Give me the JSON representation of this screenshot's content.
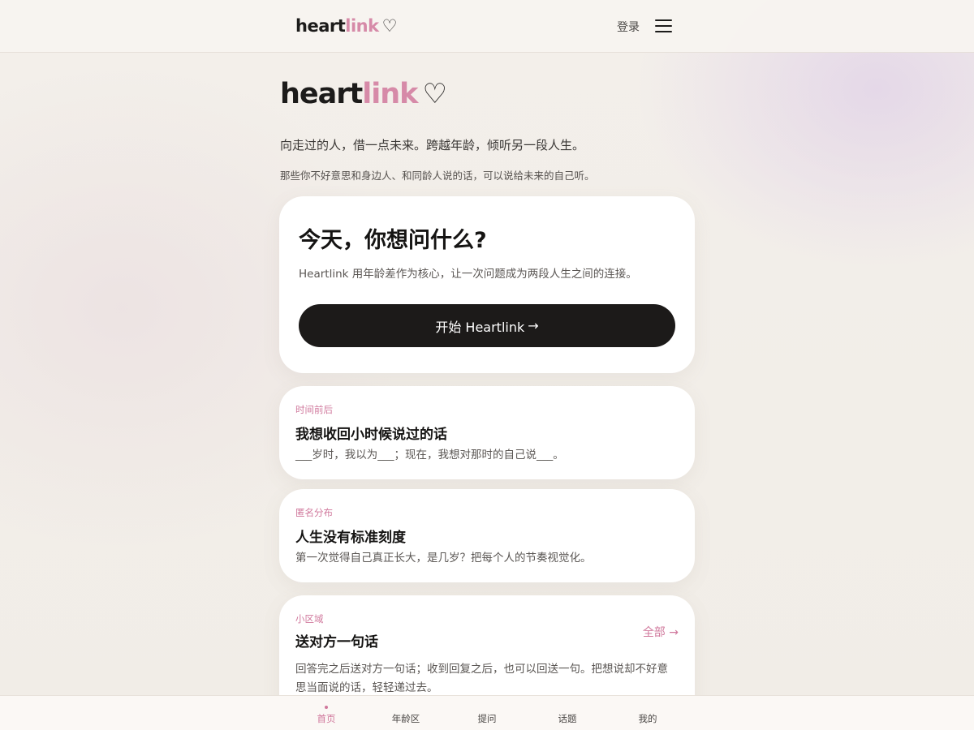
{
  "brand": {
    "part1": "heart",
    "part2": "link",
    "symbol": "♡"
  },
  "header": {
    "login_label": "登录"
  },
  "hero": {
    "tagline": "向走过的人，借一点未来。跨越年龄，倾听另一段人生。",
    "subtagline": "那些你不好意思和身边人、和同龄人说的话，可以说给未来的自己听。"
  },
  "main_card": {
    "title": "今天，你想问什么?",
    "description": "Heartlink 用年龄差作为核心，让一次问题成为两段人生之间的连接。",
    "button_label": "开始 Heartlink",
    "button_arrow": "→"
  },
  "topics": [
    {
      "tag": "时间前后",
      "title": "我想收回小时候说过的话",
      "description": "___岁时，我以为___；现在，我想对那时的自己说___。"
    },
    {
      "tag": "匿名分布",
      "title": "人生没有标准刻度",
      "description": "第一次觉得自己真正长大，是几岁？把每个人的节奏视觉化。"
    },
    {
      "tag": "小区域",
      "title": "送对方一句话",
      "description": "回答完之后送对方一句话；收到回复之后，也可以回送一句。把想说却不好意思当面说的话，轻轻递过去。",
      "link_label": "全部 →"
    }
  ],
  "bottom_nav": {
    "items": [
      {
        "label": "首页",
        "active": true
      },
      {
        "label": "年龄区",
        "active": false
      },
      {
        "label": "提问",
        "active": false
      },
      {
        "label": "话题",
        "active": false
      },
      {
        "label": "我的",
        "active": false
      }
    ]
  },
  "colors": {
    "accent": "#d0789c",
    "brand_pink": "#d68aa8",
    "dark": "#1c1a19",
    "background": "#f3efea"
  }
}
